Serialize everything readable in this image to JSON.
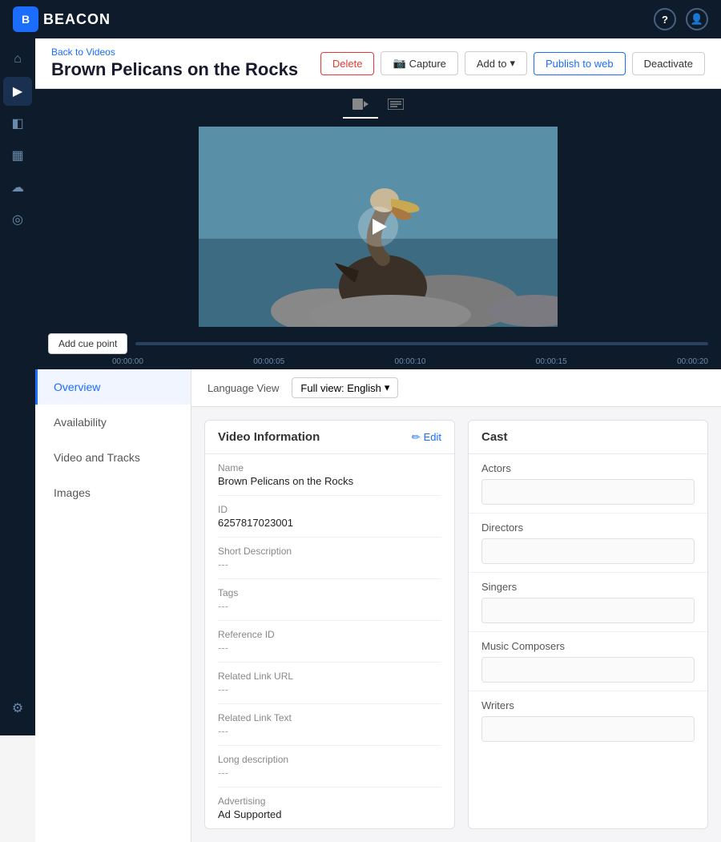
{
  "app": {
    "name": "BEACON",
    "logo_letter": "B"
  },
  "header": {
    "back_link": "Back to Videos",
    "title": "Brown Pelicans on the Rocks",
    "actions": {
      "delete": "Delete",
      "capture": "Capture",
      "add_to": "Add to",
      "publish": "Publish to web",
      "deactivate": "Deactivate"
    }
  },
  "video_tabs": [
    {
      "id": "video",
      "label": "▶",
      "active": true
    },
    {
      "id": "text",
      "label": "⊞",
      "active": false
    }
  ],
  "timeline": {
    "add_cue": "Add cue point",
    "timestamps": [
      "00:00:00",
      "00:00:05",
      "00:00:10",
      "00:00:15",
      "00:00:20"
    ]
  },
  "left_nav": [
    {
      "id": "overview",
      "label": "Overview",
      "active": true
    },
    {
      "id": "availability",
      "label": "Availability",
      "active": false
    },
    {
      "id": "video-tracks",
      "label": "Video and Tracks",
      "active": false
    },
    {
      "id": "images",
      "label": "Images",
      "active": false
    }
  ],
  "language_view": {
    "label": "Language View",
    "selected": "Full view: English"
  },
  "video_info": {
    "title": "Video Information",
    "edit_label": "Edit",
    "fields": [
      {
        "id": "name",
        "label": "Name",
        "value": "Brown Pelicans on the Rocks",
        "empty": false
      },
      {
        "id": "id",
        "label": "ID",
        "value": "6257817023001",
        "empty": false
      },
      {
        "id": "short-desc",
        "label": "Short Description",
        "value": "---",
        "empty": true
      },
      {
        "id": "tags",
        "label": "Tags",
        "value": "---",
        "empty": true
      },
      {
        "id": "reference-id",
        "label": "Reference ID",
        "value": "---",
        "empty": true
      },
      {
        "id": "related-link-url",
        "label": "Related Link URL",
        "value": "---",
        "empty": true
      },
      {
        "id": "related-link-text",
        "label": "Related Link Text",
        "value": "---",
        "empty": true
      },
      {
        "id": "long-desc",
        "label": "Long description",
        "value": "---",
        "empty": true
      },
      {
        "id": "advertising",
        "label": "Advertising",
        "value": "Ad Supported",
        "empty": false
      }
    ]
  },
  "cast": {
    "title": "Cast",
    "sections": [
      {
        "id": "actors",
        "label": "Actors"
      },
      {
        "id": "directors",
        "label": "Directors"
      },
      {
        "id": "singers",
        "label": "Singers"
      },
      {
        "id": "music-composers",
        "label": "Music Composers"
      },
      {
        "id": "writers",
        "label": "Writers"
      }
    ]
  },
  "sidebar_icons": [
    {
      "id": "home",
      "icon": "⌂",
      "active": false
    },
    {
      "id": "video",
      "icon": "▶",
      "active": true
    },
    {
      "id": "layers",
      "icon": "◧",
      "active": false
    },
    {
      "id": "calendar",
      "icon": "▦",
      "active": false
    },
    {
      "id": "cloud",
      "icon": "☁",
      "active": false
    },
    {
      "id": "bell",
      "icon": "◎",
      "active": false
    }
  ]
}
